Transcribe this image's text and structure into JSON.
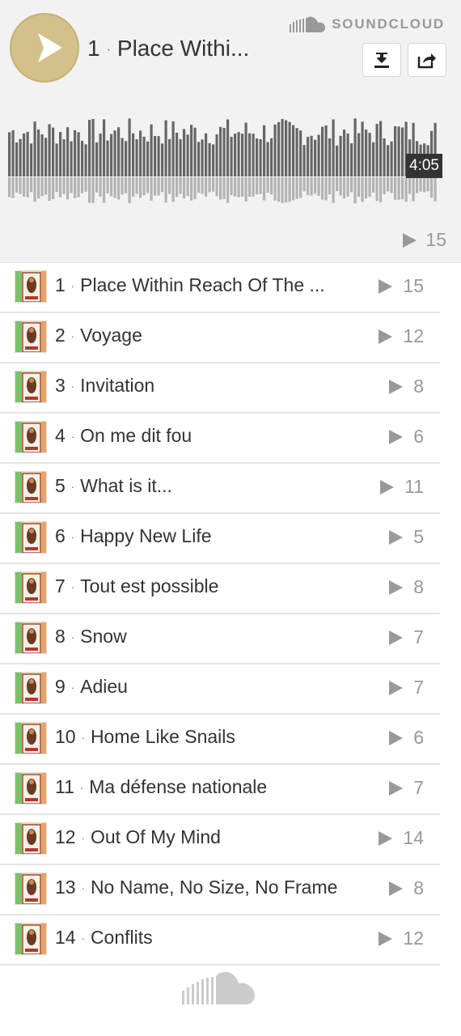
{
  "header": {
    "current_track": {
      "number": "1",
      "title": "Place Withi..."
    },
    "brand": "SOUNDCLOUD",
    "duration": "4:05",
    "plays": "15",
    "icons": {
      "play": "play-icon",
      "download": "download-icon",
      "share": "share-icon",
      "logo": "soundcloud-logo"
    }
  },
  "tracks": [
    {
      "number": "1",
      "title": "Place Within Reach Of The ...",
      "plays": "15"
    },
    {
      "number": "2",
      "title": "Voyage",
      "plays": "12"
    },
    {
      "number": "3",
      "title": "Invitation",
      "plays": "8"
    },
    {
      "number": "4",
      "title": "On me dit fou",
      "plays": "6"
    },
    {
      "number": "5",
      "title": "What is it...",
      "plays": "11"
    },
    {
      "number": "6",
      "title": "Happy New Life",
      "plays": "5"
    },
    {
      "number": "7",
      "title": "Tout est possible",
      "plays": "8"
    },
    {
      "number": "8",
      "title": "Snow",
      "plays": "7"
    },
    {
      "number": "9",
      "title": "Adieu",
      "plays": "7"
    },
    {
      "number": "10",
      "title": "Home Like Snails",
      "plays": "6"
    },
    {
      "number": "11",
      "title": "Ma défense nationale",
      "plays": "7"
    },
    {
      "number": "12",
      "title": "Out Of My Mind",
      "plays": "14"
    },
    {
      "number": "13",
      "title": "No Name, No Size, No Frame",
      "plays": "8"
    },
    {
      "number": "14",
      "title": "Conflits",
      "plays": "12"
    }
  ],
  "colors": {
    "play_button": "#d4c08a",
    "waveform_played": "#666666",
    "waveform_reflection": "#b3b3b3",
    "muted_text": "#999999"
  }
}
